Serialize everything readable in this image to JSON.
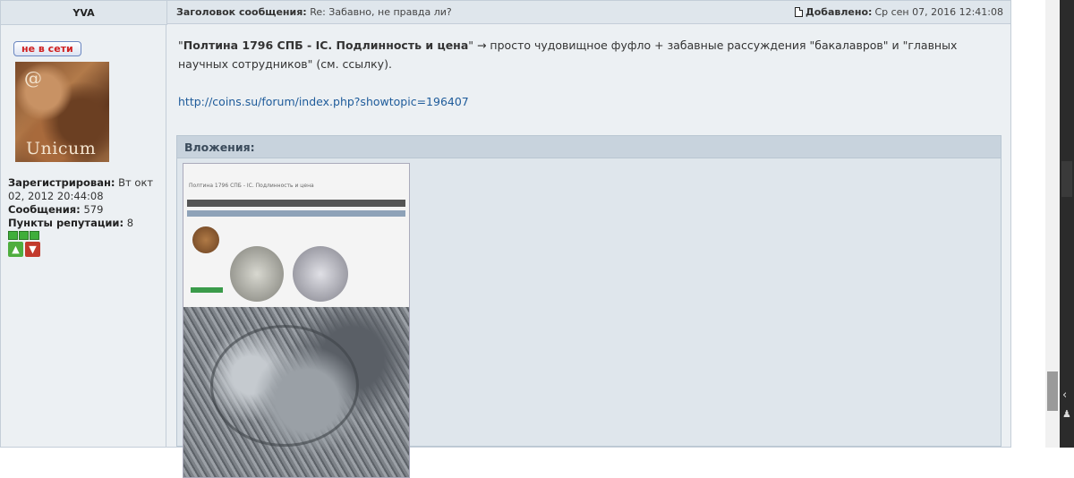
{
  "post": {
    "author": "YVA",
    "subject_label": "Заголовок сообщения:",
    "subject": "Re: Забавно, не правда ли?",
    "date_label": "Добавлено:",
    "date": "Ср сен 07, 2016 12:41:08"
  },
  "profile": {
    "status": "не в сети",
    "avatar_text_top": "@",
    "avatar_text_bottom": "Unicum",
    "registered_label": "Зарегистрирован:",
    "registered_value": "Вт окт 02, 2012 20:44:08",
    "messages_label": "Сообщения:",
    "messages_value": "579",
    "reputation_label": "Пункты репутации:",
    "reputation_value": "8"
  },
  "body": {
    "quote_open": "\"",
    "title": "Полтина 1796 СПБ - IC. Подлинность и цена",
    "quote_close": "\"",
    "text": " → просто чудовищное фуфло + забавные рассуждения \"бакалавров\" и \"главных научных сотрудников\" (см. ссылку).",
    "link": "http://coins.su/forum/index.php?showtopic=196407"
  },
  "attachments": {
    "label": "Вложения:",
    "mini_title": "Полтина 1796 СПБ - IC. Подлинность и цена"
  },
  "colors": {
    "accent": "#1e5b9a",
    "status_red": "#d02020",
    "header_bg": "#dfe6ec"
  },
  "icons": [
    "doc-icon",
    "thumbs-up-icon",
    "thumbs-down-icon",
    "chevron-left-icon",
    "pawn-icon"
  ]
}
